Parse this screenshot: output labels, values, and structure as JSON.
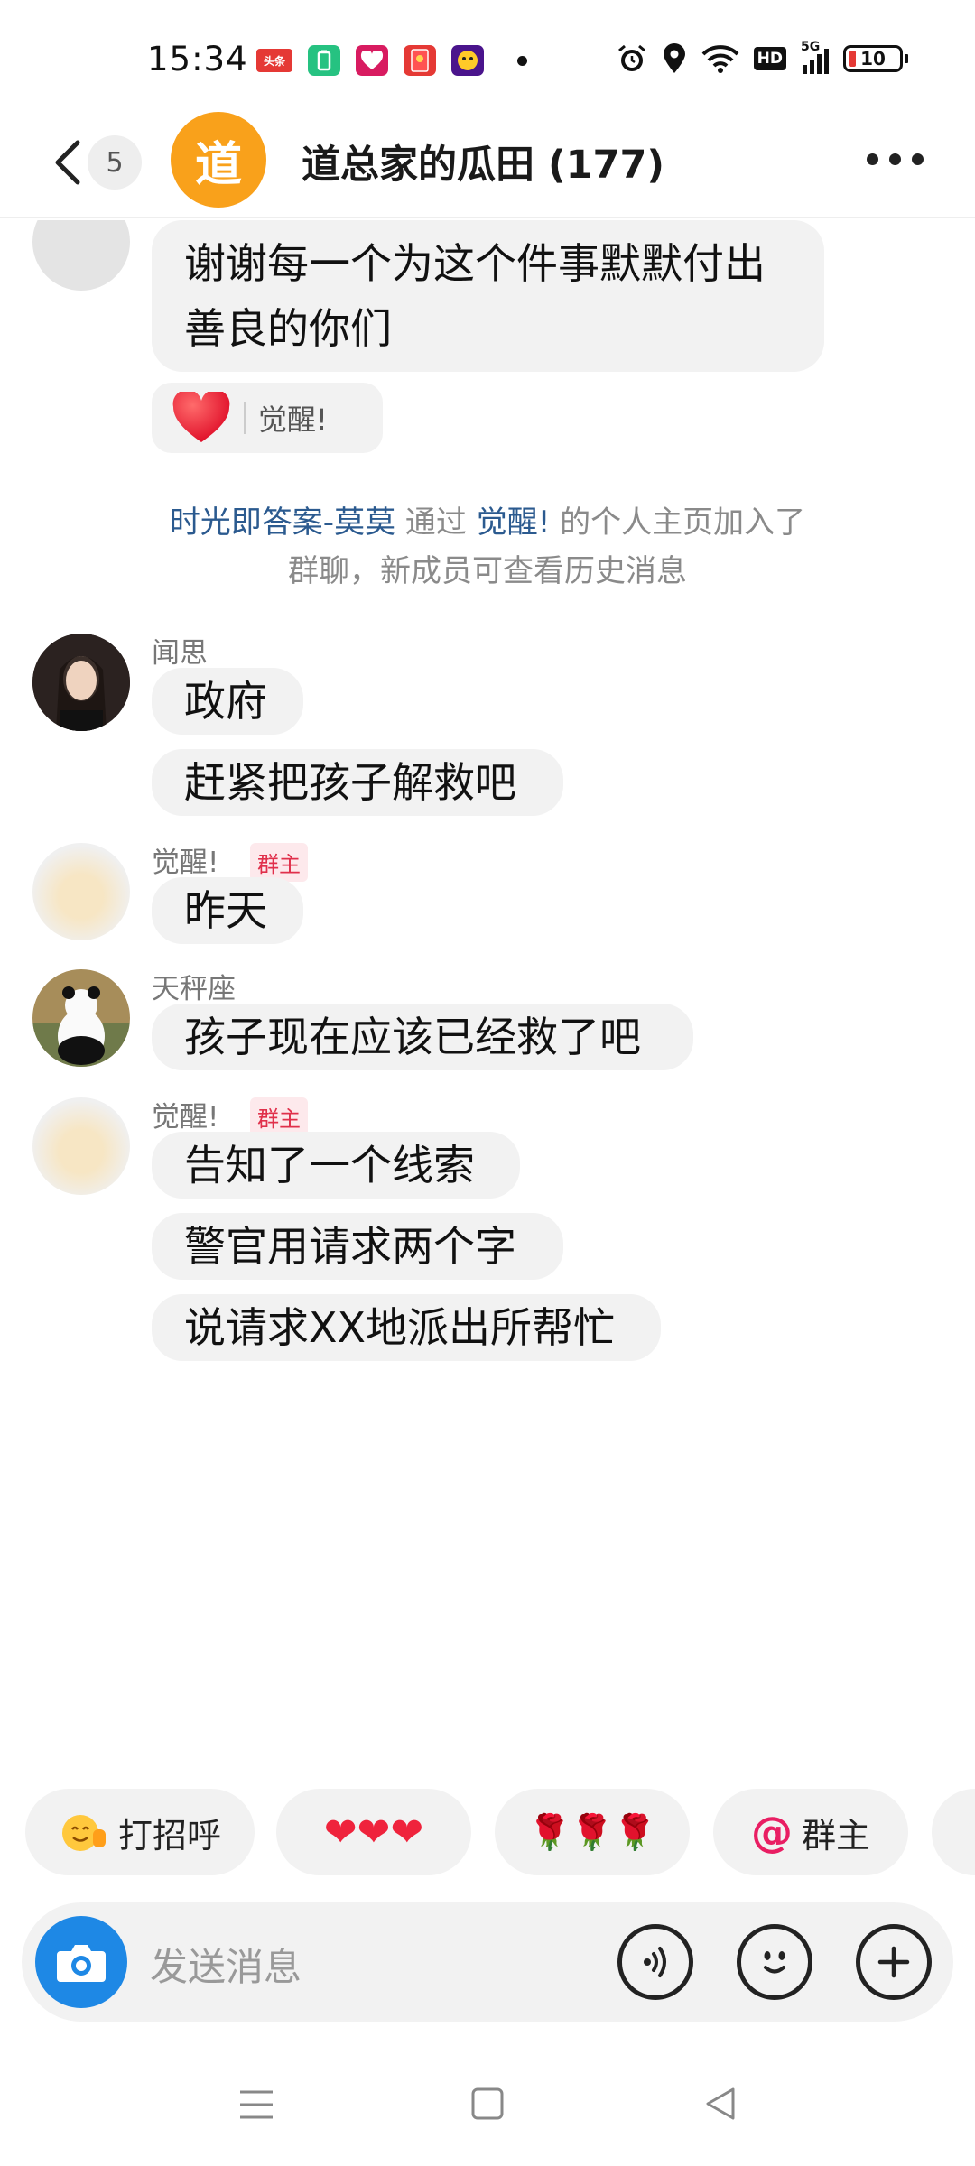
{
  "status_bar": {
    "time": "15:34",
    "app_icons": [
      {
        "name": "toutiao-icon",
        "text": "头条",
        "color": "#e53935"
      },
      {
        "name": "battery-app-icon",
        "text": "",
        "color": "#26c281"
      },
      {
        "name": "lottery-icon",
        "text": "",
        "color": "#d81b60"
      },
      {
        "name": "red-packet-icon",
        "text": "",
        "color": "#e53935"
      },
      {
        "name": "game-app-icon",
        "text": "",
        "color": "#6a1b9a"
      }
    ],
    "network": "5G",
    "hd": "HD",
    "battery": "10"
  },
  "header": {
    "back_count": "5",
    "group_avatar_text": "道",
    "title": "道总家的瓜田 (177)"
  },
  "messages": {
    "top_bubble": "谢谢每一个为这个件事默默付出善良的你们",
    "top_bubble_line1": "谢谢每一个为这个件事默默付出",
    "top_bubble_line2": "善良的你们",
    "reaction_who": "觉醒!",
    "system_user": "时光即答案-莫莫",
    "system_via": " 通过 ",
    "system_inviter": "觉醒!",
    "system_rest1": " 的个人主页加入了",
    "system_rest2": "群聊，新成员可查看历史消息",
    "wensi_name": "闻思",
    "wensi_1": "政府",
    "wensi_2": "赶紧把孩子解救吧",
    "juexing_name": "觉醒!",
    "owner_tag": "群主",
    "juexing_1": "昨天",
    "tianping_name": "天秤座",
    "tianping_1": "孩子现在应该已经救了吧",
    "juexing2_name": "觉醒!",
    "owner_tag2": "群主",
    "juexing2_1": "告知了一个线索",
    "juexing2_2": "警官用请求两个字",
    "juexing2_3": "说请求XX地派出所帮忙"
  },
  "quick_replies": {
    "greet": "打招呼",
    "hearts": "❤❤❤",
    "roses": "🌹🌹🌹",
    "at_symbol": "@",
    "at_owner": "群主"
  },
  "input": {
    "placeholder": "发送消息"
  },
  "colors": {
    "accent_blue": "#1e88e5",
    "group_orange": "#f9a11b",
    "bubble_bg": "#f2f2f2",
    "link": "#2b5a8f",
    "owner_red": "#e0304b"
  }
}
